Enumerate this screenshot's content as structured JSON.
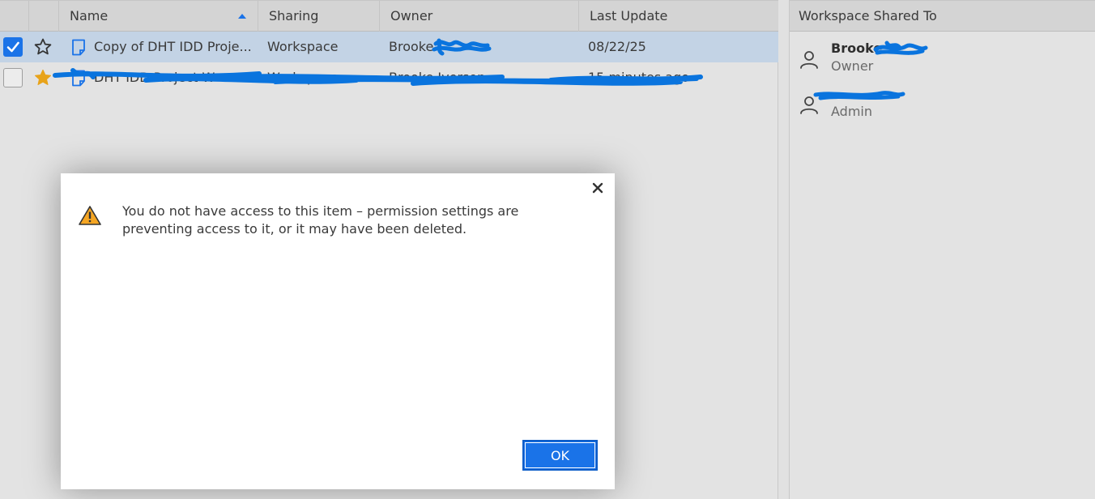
{
  "table": {
    "columns": {
      "name": "Name",
      "sharing": "Sharing",
      "owner": "Owner",
      "last_update": "Last Update"
    },
    "rows": [
      {
        "name": "Copy of DHT IDD Proje...",
        "sharing": "Workspace",
        "owner": "Brooke",
        "last_update": "08/22/25",
        "selected": true,
        "starred": false
      },
      {
        "name": "DHT IDD Project W",
        "sharing": "Workspace",
        "owner": "Brooke Iverson",
        "last_update": "15 minutes ago",
        "selected": false,
        "starred": true
      }
    ]
  },
  "side_panel": {
    "title": "Workspace Shared To",
    "members": [
      {
        "name": "Brooke",
        "role": "Owner"
      },
      {
        "name": "",
        "role": "Admin"
      }
    ]
  },
  "dialog": {
    "message": "You do not have access to this item – permission settings are preventing access to it, or it may have been deleted.",
    "ok_label": "OK"
  },
  "colors": {
    "accent": "#1a73e8",
    "star": "#e8a31a",
    "selected_row": "#c3d3e5",
    "redaction": "#0a74de"
  }
}
